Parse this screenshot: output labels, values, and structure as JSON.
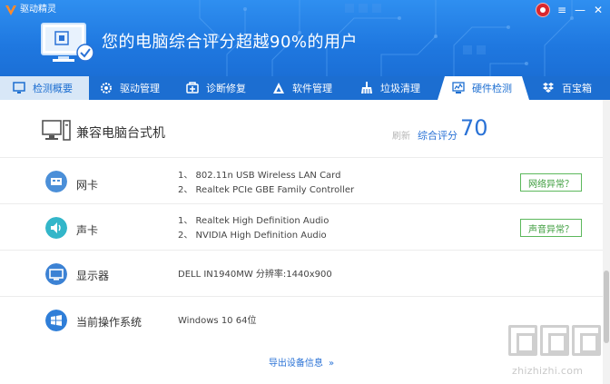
{
  "app": {
    "title": "驱动精灵"
  },
  "window_controls": {
    "menu_glyph": "≡",
    "minimize_glyph": "—",
    "close_glyph": "✕"
  },
  "header": {
    "headline": "您的电脑综合评分超越90%的用户"
  },
  "tabs": [
    {
      "label": "检测概要",
      "icon": "monitor-check-icon"
    },
    {
      "label": "驱动管理",
      "icon": "gear-icon"
    },
    {
      "label": "诊断修复",
      "icon": "tools-icon"
    },
    {
      "label": "软件管理",
      "icon": "triangle-app-icon"
    },
    {
      "label": "垃圾清理",
      "icon": "broom-icon"
    },
    {
      "label": "硬件检测",
      "icon": "chart-monitor-icon",
      "active": true
    },
    {
      "label": "百宝箱",
      "icon": "dropbox-icon"
    }
  ],
  "summary": {
    "title": "兼容电脑台式机",
    "refresh_label": "刷新",
    "score_label": "综合评分",
    "score": "70"
  },
  "hardware": [
    {
      "label": "网卡",
      "icon": "network-card-icon",
      "details": [
        "1、 802.11n USB Wireless LAN Card",
        "2、 Realtek PCIe GBE Family Controller"
      ],
      "status": "网络异常？"
    },
    {
      "label": "声卡",
      "icon": "speaker-icon",
      "details": [
        "1、 Realtek High Definition Audio",
        "2、 NVIDIA High Definition Audio"
      ],
      "status": "声音异常？"
    },
    {
      "label": "显示器",
      "icon": "display-icon",
      "details": [
        "DELL IN1940MW  分辨率:1440x900"
      ],
      "status": ""
    },
    {
      "label": "当前操作系统",
      "icon": "windows-icon",
      "details": [
        "Windows 10 64位"
      ],
      "status": ""
    }
  ],
  "export": {
    "label": "导出设备信息",
    "arrow": "»"
  },
  "watermark": {
    "text": "zhizhizhi.com"
  },
  "colors": {
    "header_blue": "#1f78e0",
    "accent_blue": "#2a72d6",
    "status_green": "#3c9c3c"
  }
}
